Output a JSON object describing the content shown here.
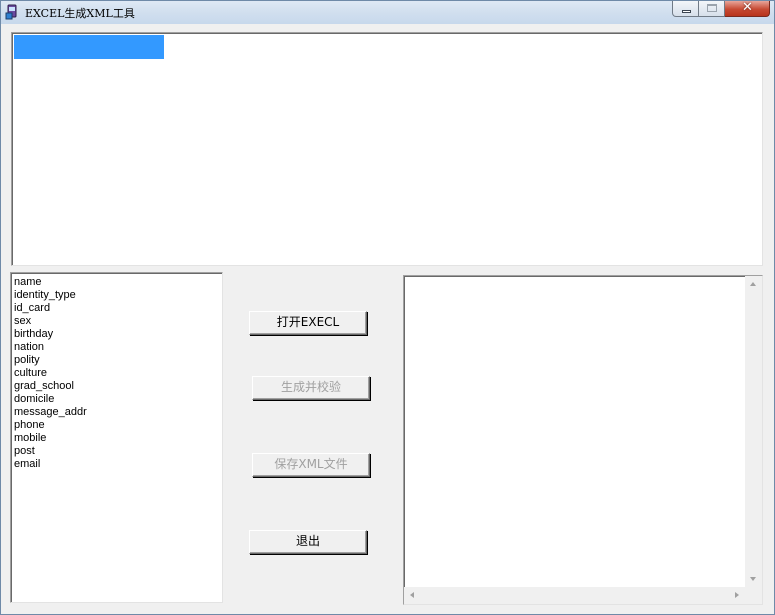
{
  "window": {
    "title": "EXCEL生成XML工具",
    "close_glyph": "✕",
    "icon": "app-icon"
  },
  "fields": [
    "name",
    "identity_type",
    "id_card",
    "sex",
    "birthday",
    "nation",
    "polity",
    "culture",
    "grad_school",
    "domicile",
    "message_addr",
    "phone",
    "mobile",
    "post",
    "email"
  ],
  "buttons": {
    "open": "打开EXECL",
    "generate": "生成并校验",
    "save": "保存XML文件",
    "exit": "退出"
  },
  "colors": {
    "selection": "#3399ff",
    "disabled_text": "#a0a0a0"
  }
}
